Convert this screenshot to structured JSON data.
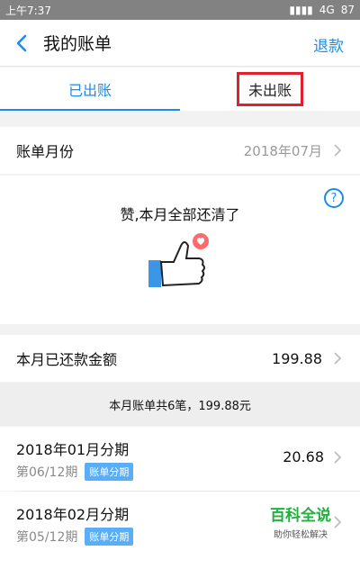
{
  "status_bar": {
    "time": "上午7:37",
    "network": "4G",
    "battery": "87"
  },
  "header": {
    "title": "我的账单",
    "right_action": "退款"
  },
  "tabs": [
    {
      "label": "已出账",
      "active": true
    },
    {
      "label": "未出账",
      "active": false
    }
  ],
  "bill_month": {
    "label": "账单月份",
    "value": "2018年07月"
  },
  "praise": {
    "text": "赞,本月全部还清了",
    "help_icon": "question-circle-icon",
    "illustration": "thumbs-up-heart-icon"
  },
  "repaid": {
    "label": "本月已还款金额",
    "value": "199.88"
  },
  "summary": "本月账单共6笔，199.88元",
  "items": [
    {
      "name": "2018年01月分期",
      "period": "第06/12期",
      "tag": "账单分期",
      "amount": "20.68"
    },
    {
      "name": "2018年02月分期",
      "period": "第05/12期",
      "tag": "账单分期",
      "amount": ""
    }
  ],
  "watermark": {
    "title": "百科全说",
    "subtitle": "助你轻松解决"
  },
  "colors": {
    "accent": "#1a8cf0",
    "highlight": "#e0202a",
    "tag": "#5aaef7",
    "watermark": "#1db33a"
  }
}
